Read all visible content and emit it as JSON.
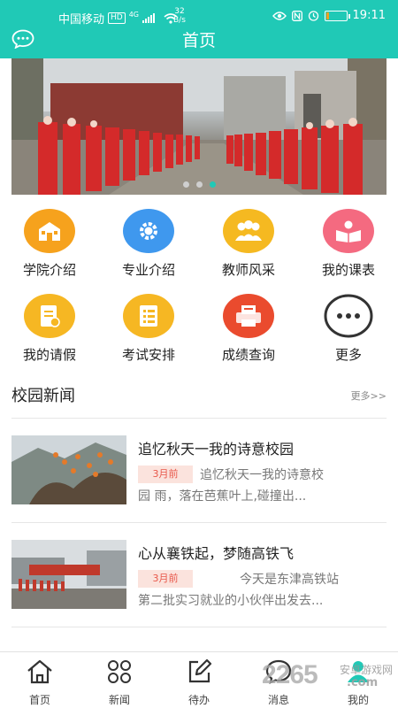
{
  "status_bar": {
    "carrier": "中国移动",
    "network_badge": "HD",
    "signal_type": "4G",
    "speed_value": "32",
    "speed_unit": "B/s",
    "time": "19:11",
    "battery_level": 0.15
  },
  "header": {
    "title": "首页",
    "chat_icon": "chat-bubble-icon"
  },
  "banner": {
    "slide_count": 3,
    "active_slide": 3,
    "accent": "#20c9b6"
  },
  "quick_links": [
    {
      "label": "学院介绍",
      "icon": "school-building-icon",
      "color": "#f6a21d"
    },
    {
      "label": "专业介绍",
      "icon": "gear-icon",
      "color": "#3f98ee"
    },
    {
      "label": "教师风采",
      "icon": "people-icon",
      "color": "#f5b921"
    },
    {
      "label": "我的课表",
      "icon": "book-icon",
      "color": "#f46a80"
    },
    {
      "label": "我的请假",
      "icon": "leave-form-icon",
      "color": "#f6b723"
    },
    {
      "label": "考试安排",
      "icon": "exam-list-icon",
      "color": "#f6b723"
    },
    {
      "label": "成绩查询",
      "icon": "score-printer-icon",
      "color": "#ea4b2e"
    },
    {
      "label": "更多",
      "icon": "more-dots-icon",
      "color": "#333333"
    }
  ],
  "news_section": {
    "title": "校园新闻",
    "more_label": "更多>>",
    "items": [
      {
        "title": "追忆秋天一我的诗意校园",
        "time": "3月前",
        "summary_line1": "追忆秋天一我的诗意校",
        "summary_line2": "园    雨，落在芭蕉叶上,碰撞出..."
      },
      {
        "title": "心从襄铁起，梦随高铁飞",
        "time": "3月前",
        "summary_line1": "今天是东津高铁站",
        "summary_line2": "第二批实习就业的小伙伴出发去..."
      }
    ]
  },
  "tab_bar": [
    {
      "label": "首页",
      "icon": "home-icon"
    },
    {
      "label": "新闻",
      "icon": "grid-icon"
    },
    {
      "label": "待办",
      "icon": "edit-icon"
    },
    {
      "label": "消息",
      "icon": "message-icon"
    },
    {
      "label": "我的",
      "icon": "profile-icon"
    }
  ],
  "watermark": {
    "text": "2265",
    "suffix": ".com",
    "site": "安卓游戏网"
  }
}
